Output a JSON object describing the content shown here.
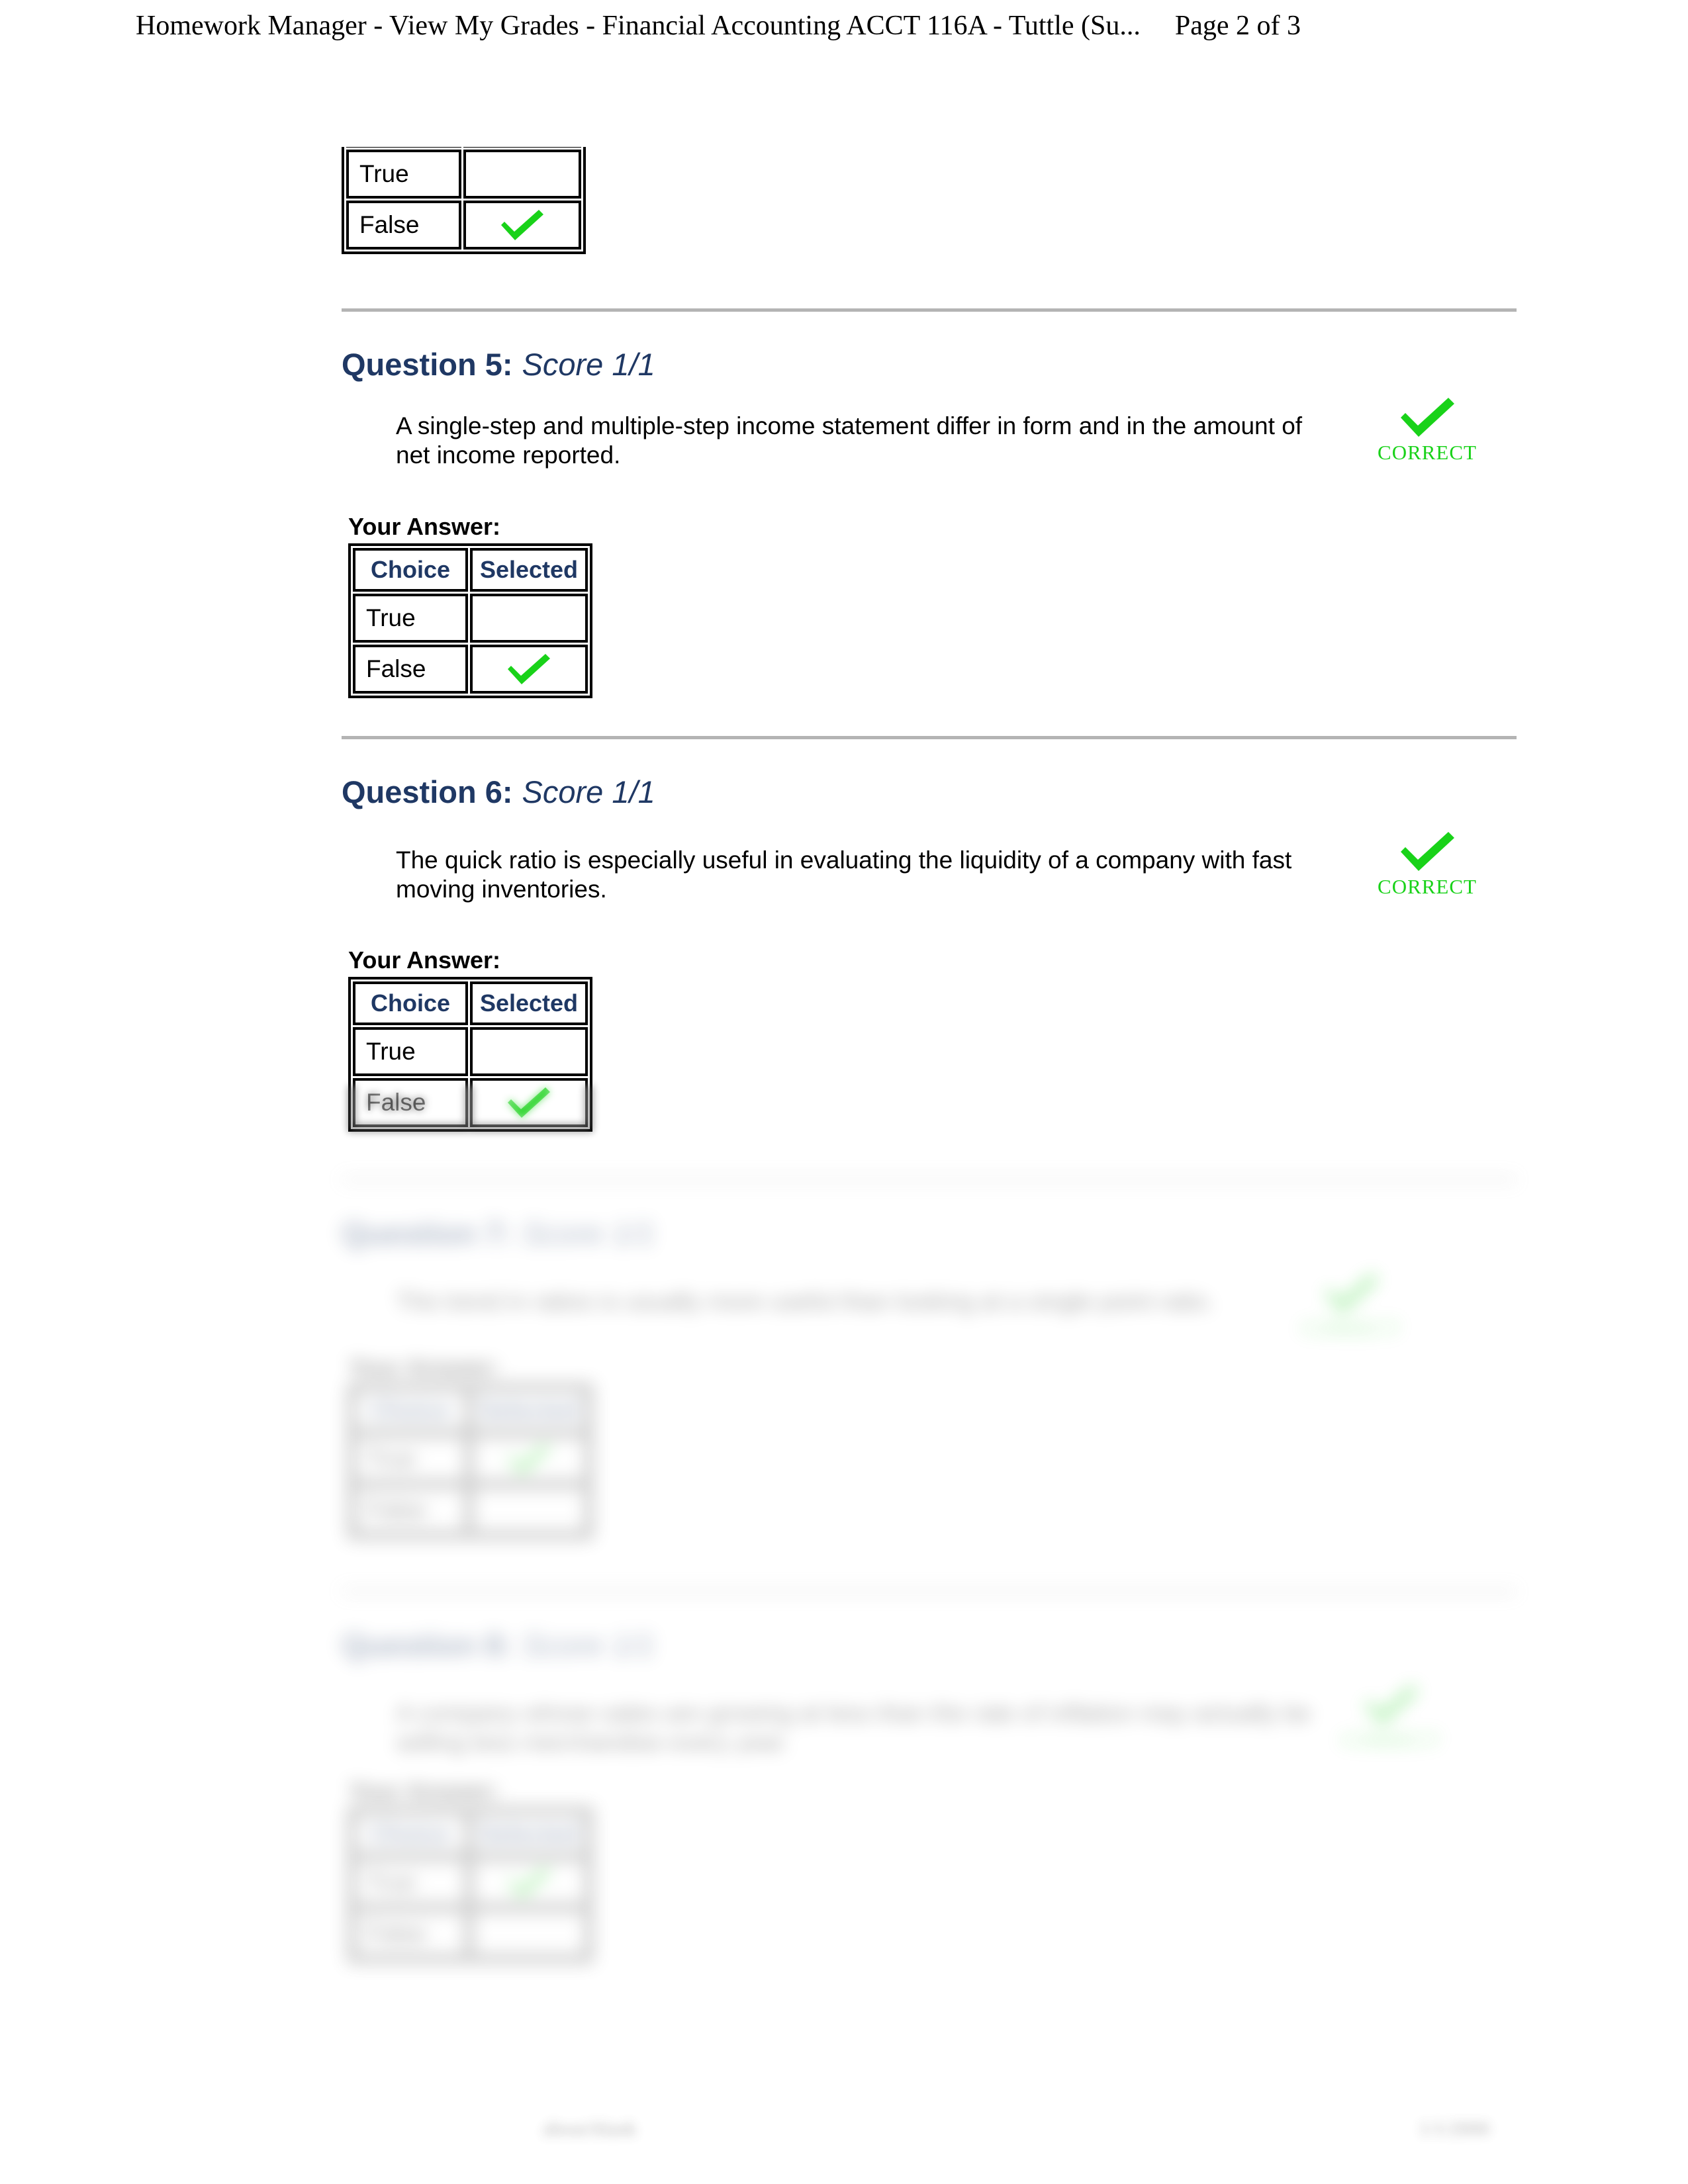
{
  "print_header": {
    "title": "Homework Manager - View My Grades - Financial Accounting ACCT 116A - Tuttle (Su...",
    "page_indicator": "Page 2 of 3"
  },
  "labels": {
    "your_answer": "Your Answer:",
    "correct_stamp": "CORRECT",
    "choice_header": "Choice",
    "selected_header": "Selected",
    "choice_true": "True",
    "choice_false": "False",
    "check_icon": "green-check-icon"
  },
  "colors": {
    "heading_navy": "#1f3864",
    "check_green": "#19d219",
    "rule_gray": "#b4b4b4",
    "text_black": "#000000",
    "page_background": "#ffffff"
  },
  "top_partial_table": {
    "note": "continuation of previous question's answer table, clipped by page break",
    "rows": [
      {
        "choice": "True",
        "selected": false
      },
      {
        "choice": "False",
        "selected": true
      }
    ]
  },
  "questions": [
    {
      "number": "Question 5:",
      "score": "Score 1/1",
      "text": "A single-step and multiple-step income statement differ in form and in the amount of net income reported.",
      "result": "CORRECT",
      "rows": [
        {
          "choice": "True",
          "selected": false
        },
        {
          "choice": "False",
          "selected": true
        }
      ]
    },
    {
      "number": "Question 6:",
      "score": "Score 1/1",
      "text": "The quick ratio is especially useful in evaluating the liquidity of a company with fast moving inventories.",
      "result": "CORRECT",
      "rows": [
        {
          "choice": "True",
          "selected": false
        },
        {
          "choice": "False",
          "selected": true
        }
      ]
    },
    {
      "number": "Question 7:",
      "score": "Score 1/1",
      "text": "The trend in ratios is usually more useful than looking at a single point ratio.",
      "result": "CORRECT",
      "rows": [
        {
          "choice": "True",
          "selected": true
        },
        {
          "choice": "False",
          "selected": false
        }
      ]
    },
    {
      "number": "Question 8:",
      "score": "Score 1/1",
      "text": "A company whose sales are growing at less than the rate of inflation may actually be selling less merchandise every year.",
      "result": "CORRECT",
      "rows": [
        {
          "choice": "True",
          "selected": true
        },
        {
          "choice": "False",
          "selected": false
        }
      ]
    }
  ],
  "print_footer": {
    "left": "about:blank",
    "right": "1/1/2000"
  }
}
